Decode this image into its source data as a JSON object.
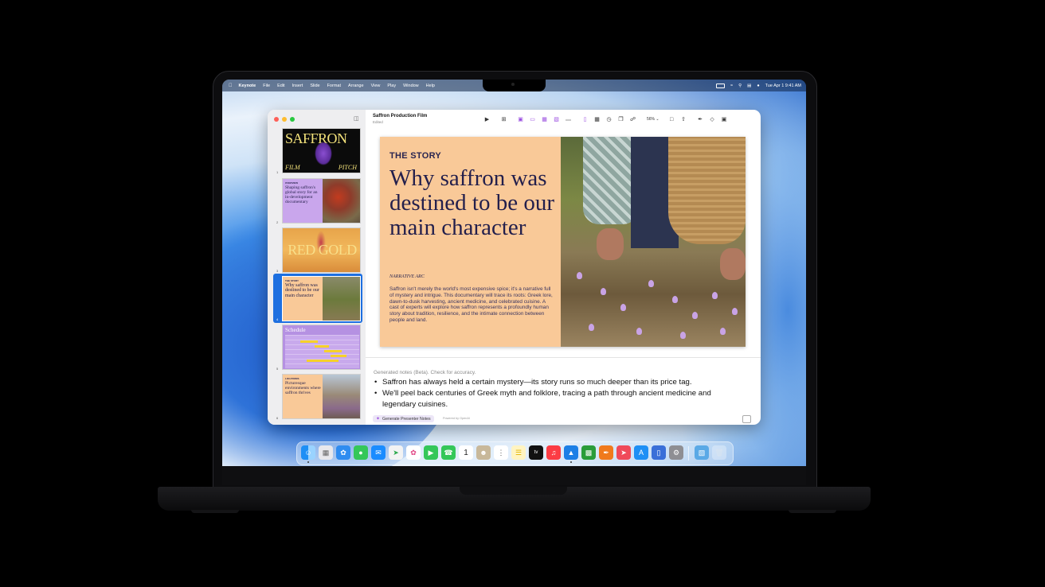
{
  "menubar": {
    "app": "Keynote",
    "items": [
      "File",
      "Edit",
      "Insert",
      "Slide",
      "Format",
      "Arrange",
      "View",
      "Play",
      "Window",
      "Help"
    ],
    "clock": "Tue Apr 1  9:41 AM"
  },
  "document": {
    "title": "Saffron Production Film",
    "status": "Edited",
    "zoom": "56%"
  },
  "thumbnails": [
    {
      "num": "1",
      "title": "SAFFRON",
      "sub_left": "FILM",
      "sub_right": "PITCH"
    },
    {
      "num": "2",
      "kicker": "OVERVIEW",
      "title": "Shaping saffron's global story for an in-development documentary"
    },
    {
      "num": "3",
      "title": "RED GOLD"
    },
    {
      "num": "4",
      "kicker": "THE STORY",
      "title": "Why saffron was destined to be our main character"
    },
    {
      "num": "5",
      "title": "Schedule"
    },
    {
      "num": "6",
      "kicker": "LOCATIONS",
      "title": "Picturesque environments where saffron thrives"
    }
  ],
  "slide": {
    "kicker": "THE STORY",
    "headline": "Why saffron was destined to be our main character",
    "arc_label": "NARRATIVE ARC",
    "body": "Saffron isn't merely the world's most expensive spice; it's a narrative full of mystery and intrigue. This documentary will trace its roots: Greek lore, dawn-to-dusk harvesting, ancient medicine, and celebrated cuisine. A cast of experts will explore how saffron represents a profoundly human story about tradition, resilience, and the intimate connection between people and land."
  },
  "notes": {
    "header": "Generated notes (Beta). Check for accuracy.",
    "bullets": [
      "Saffron has always held a certain mystery—its story runs so much deeper than its price tag.",
      "We'll peel back centuries of Greek myth and folklore, tracing a path through ancient medicine and legendary cuisines."
    ],
    "button": "Generate Presenter Notes",
    "powered": "Powered by OpenAI"
  },
  "dock": {
    "calendar_day": "1",
    "tv_label": "tv"
  }
}
